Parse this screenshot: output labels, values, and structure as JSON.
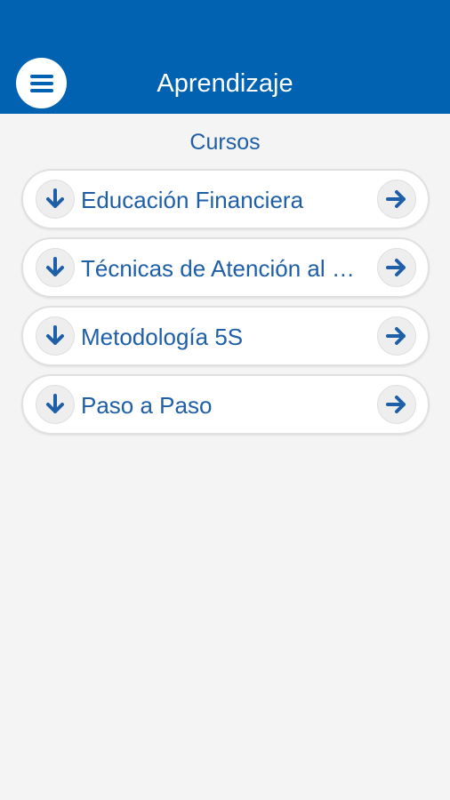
{
  "header": {
    "title": "Aprendizaje",
    "menu_icon": "hamburger-menu-icon"
  },
  "section": {
    "title": "Cursos"
  },
  "courses": [
    {
      "label": "Educación Financiera"
    },
    {
      "label": "Técnicas de Atención al Cliente"
    },
    {
      "label": "Metodología 5S"
    },
    {
      "label": "Paso a Paso"
    }
  ],
  "icons": {
    "download": "arrow-down-icon",
    "open": "arrow-right-icon"
  },
  "colors": {
    "header_bg": "#0062b1",
    "accent": "#1f5fa8",
    "background": "#f4f4f4"
  }
}
